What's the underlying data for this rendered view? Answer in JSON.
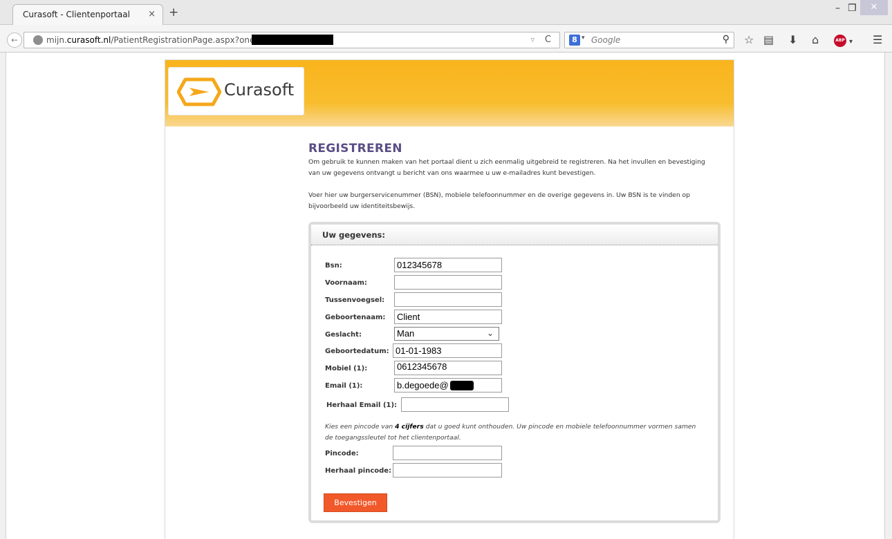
{
  "browser": {
    "tab_title": "Curasoft - Clientenportaal",
    "tab_close": "×",
    "new_tab": "+",
    "window_minimize": "–",
    "window_restore": "❐",
    "window_close": "✕",
    "back": "←",
    "url_prefix": "mijn.",
    "url_domain": "curasoft.nl",
    "url_path": "/PatientRegistrationPage.aspx?onetimelink",
    "url_dropdown": "▿",
    "reload": "C",
    "search_engine": "8",
    "search_dropdown": "▾",
    "search_placeholder": "Google",
    "search_go": "⚲",
    "toolbar_icons": [
      "star-icon",
      "reading-list-icon",
      "download-icon",
      "home-icon",
      "adblock-icon",
      "menu-icon"
    ],
    "adblock_label": "ABP"
  },
  "header": {
    "logo_text": "Curasoft",
    "brand_color": "#f9b41c"
  },
  "content": {
    "title": "REGISTREREN",
    "intro_line1": "Om gebruik te kunnen maken van het portaal dient u zich eenmalig uitgebreid te registreren. Na het invullen en bevestiging",
    "intro_line2": "van uw gegevens ontvangt u bericht van ons waarmee u uw e-mailadres kunt bevestigen.",
    "intro2_line1": "Voer hier uw burgerservicenummer (BSN), mobiele telefoonnummer en de overige gegevens in. Uw BSN is te vinden op",
    "intro2_line2": "bijvoorbeeld uw identiteitsbewijs."
  },
  "form": {
    "panel_title": "Uw gegevens:",
    "fields": [
      {
        "label": "Bsn:",
        "value": ""
      },
      {
        "label": "Voornaam:",
        "value": ""
      },
      {
        "label": "Tussenvoegsel:",
        "value": ""
      },
      {
        "label": "Geboortenaam:",
        "value": "Client"
      },
      {
        "label": "Geslacht:",
        "value": "Man"
      },
      {
        "label": "Geboortedatum:",
        "value": "01-01-1983"
      },
      {
        "label": "Mobiel (1):",
        "value": "0612345678"
      },
      {
        "label": "Email (1):",
        "value": "b.degoede@"
      },
      {
        "label": "Herhaal Email (1):",
        "value": ""
      }
    ],
    "bsn_value": "012345678",
    "select_arrow": "⌄",
    "hint_part1": "Kies een pincode van ",
    "hint_bold": "4 cijfers",
    "hint_part2": " dat u goed kunt onthouden. Uw pincode en mobiele telefoonnummer vormen samen",
    "hint_line2": "de toegangssleutel tot het clientenportaal.",
    "pin_fields": [
      {
        "label": "Pincode:",
        "value": ""
      },
      {
        "label": "Herhaal pincode:",
        "value": ""
      }
    ],
    "submit_label": "Bevestigen",
    "submit_color": "#f1592a"
  }
}
